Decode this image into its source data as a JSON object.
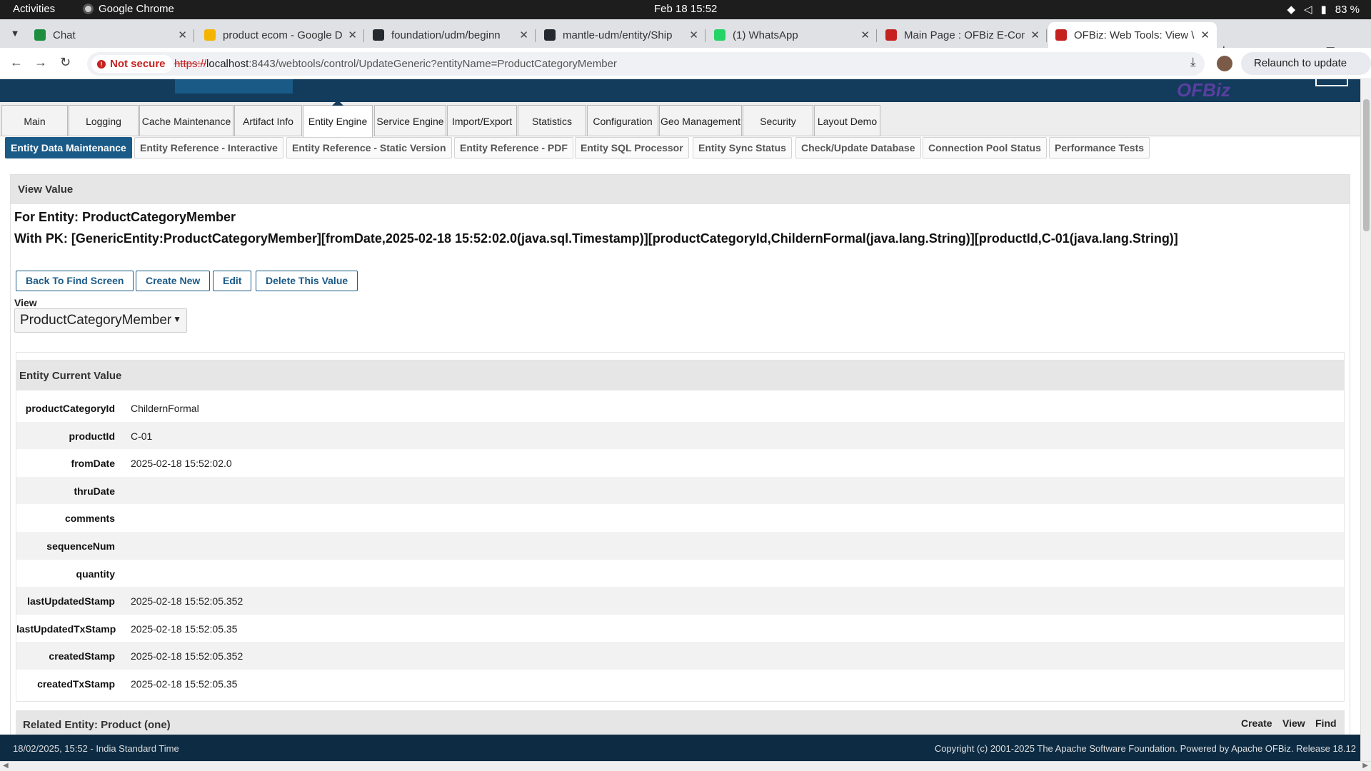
{
  "os": {
    "activities": "Activities",
    "app_name": "Google Chrome",
    "clock": "Feb 18  15:52",
    "battery": "83 %"
  },
  "browser": {
    "tabs": [
      {
        "title": "Chat",
        "icon": "google-chat-icon",
        "color": "#1e8e3e",
        "active": false
      },
      {
        "title": "product ecom - Google D",
        "icon": "google-drive-icon",
        "color": "#f4b400",
        "active": false
      },
      {
        "title": "foundation/udm/beginn",
        "icon": "github-icon",
        "color": "#24292f",
        "active": false
      },
      {
        "title": "mantle-udm/entity/Ship",
        "icon": "github-icon",
        "color": "#24292f",
        "active": false
      },
      {
        "title": "(1) WhatsApp",
        "icon": "whatsapp-icon",
        "color": "#25d366",
        "active": false
      },
      {
        "title": "Main Page : OFBiz E-Com",
        "icon": "ofbiz-icon",
        "color": "#c5221f",
        "active": false
      },
      {
        "title": "OFBiz: Web Tools: View \\",
        "icon": "ofbiz-icon",
        "color": "#c5221f",
        "active": true
      }
    ],
    "not_secure": "Not secure",
    "url_scheme": "https://",
    "url_host": "localhost",
    "url_rest": ":8443/webtools/control/UpdateGeneric?entityName=ProductCategoryMember",
    "relaunch": "Relaunch to update"
  },
  "app": {
    "logo": "OFBiz",
    "main_nav": [
      "Main",
      "Logging",
      "Cache Maintenance",
      "Artifact Info",
      "Entity Engine",
      "Service Engine",
      "Import/Export",
      "Statistics",
      "Configuration",
      "Geo Management",
      "Security",
      "Layout Demo"
    ],
    "main_nav_selected": "Entity Engine",
    "sub_nav": [
      "Entity Data Maintenance",
      "Entity Reference - Interactive",
      "Entity Reference - Static Version",
      "Entity Reference - PDF",
      "Entity SQL Processor",
      "Entity Sync Status",
      "Check/Update Database",
      "Connection Pool Status",
      "Performance Tests"
    ],
    "sub_nav_selected": "Entity Data Maintenance",
    "screenlet_title": "View Value",
    "entity_heading": "For Entity: ProductCategoryMember",
    "pk_heading": "With PK: [GenericEntity:ProductCategoryMember][fromDate,2025-02-18 15:52:02.0(java.sql.Timestamp)][productCategoryId,ChildernFormal(java.lang.String)][productId,C-01(java.lang.String)]",
    "buttons": {
      "back": "Back To Find Screen",
      "create": "Create New",
      "edit": "Edit",
      "delete": "Delete This Value"
    },
    "view_label": "View",
    "view_select": "ProductCategoryMember",
    "current_value_title": "Entity Current Value",
    "fields": [
      {
        "name": "productCategoryId",
        "value": "ChildernFormal"
      },
      {
        "name": "productId",
        "value": "C-01"
      },
      {
        "name": "fromDate",
        "value": "2025-02-18 15:52:02.0"
      },
      {
        "name": "thruDate",
        "value": ""
      },
      {
        "name": "comments",
        "value": ""
      },
      {
        "name": "sequenceNum",
        "value": ""
      },
      {
        "name": "quantity",
        "value": ""
      },
      {
        "name": "lastUpdatedStamp",
        "value": "2025-02-18 15:52:05.352"
      },
      {
        "name": "lastUpdatedTxStamp",
        "value": "2025-02-18 15:52:05.35"
      },
      {
        "name": "createdStamp",
        "value": "2025-02-18 15:52:05.352"
      },
      {
        "name": "createdTxStamp",
        "value": "2025-02-18 15:52:05.35"
      }
    ],
    "related": {
      "title": "Related Entity: Product (one)",
      "links": [
        "Create",
        "View",
        "Find"
      ]
    },
    "footer_left": "18/02/2025, 15:52 - India Standard Time",
    "footer_right": "Copyright (c) 2001-2025 The Apache Software Foundation. Powered by Apache OFBiz. Release 18.12"
  }
}
